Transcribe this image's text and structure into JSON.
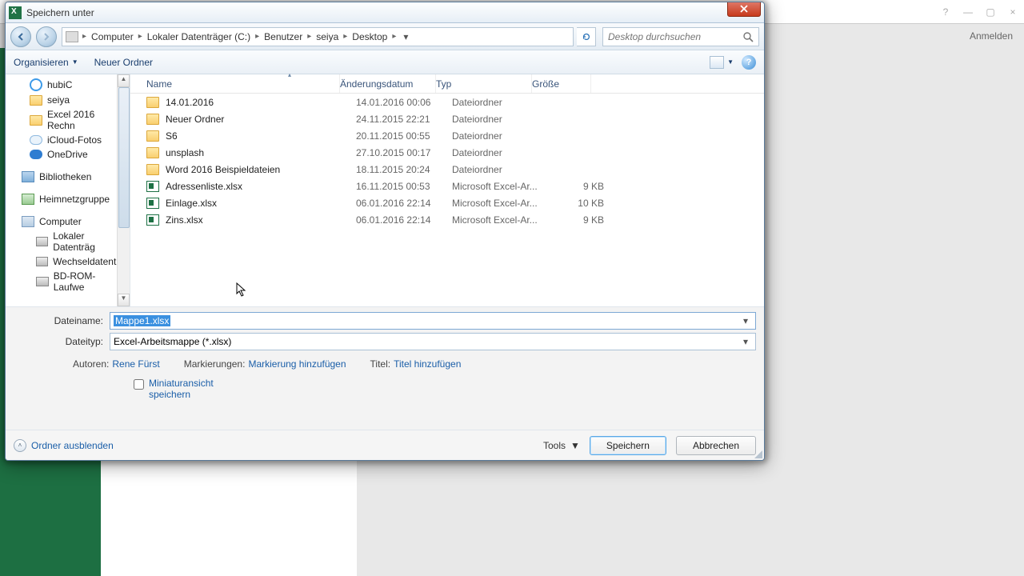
{
  "bg": {
    "anmelden": "Anmelden",
    "help": "?",
    "min": "—",
    "max": "▢",
    "close": "×"
  },
  "dialog": {
    "title": "Speichern unter",
    "breadcrumb": [
      "Computer",
      "Lokaler Datenträger (C:)",
      "Benutzer",
      "seiya",
      "Desktop"
    ],
    "search_placeholder": "Desktop durchsuchen",
    "toolbar": {
      "organize": "Organisieren",
      "new_folder": "Neuer Ordner"
    },
    "tree": [
      {
        "icon": "hubic",
        "label": "hubiC",
        "indent": "item"
      },
      {
        "icon": "folder",
        "label": "seiya",
        "indent": "item"
      },
      {
        "icon": "folder",
        "label": "Excel 2016 Rechn",
        "indent": "item"
      },
      {
        "icon": "cloud",
        "label": "iCloud-Fotos",
        "indent": "item"
      },
      {
        "icon": "onedrive",
        "label": "OneDrive",
        "indent": "item"
      },
      {
        "icon": "lib",
        "label": "Bibliotheken",
        "indent": "top"
      },
      {
        "icon": "net",
        "label": "Heimnetzgruppe",
        "indent": "top"
      },
      {
        "icon": "comp",
        "label": "Computer",
        "indent": "top"
      },
      {
        "icon": "drive",
        "label": "Lokaler Datenträg",
        "indent": "sub"
      },
      {
        "icon": "drive",
        "label": "Wechseldatenträ",
        "indent": "sub"
      },
      {
        "icon": "drive",
        "label": "BD-ROM-Laufwe",
        "indent": "sub"
      }
    ],
    "columns": {
      "name": "Name",
      "date": "Änderungsdatum",
      "type": "Typ",
      "size": "Größe"
    },
    "rows": [
      {
        "icon": "folder",
        "name": "14.01.2016",
        "date": "14.01.2016 00:06",
        "type": "Dateiordner",
        "size": ""
      },
      {
        "icon": "folder",
        "name": "Neuer Ordner",
        "date": "24.11.2015 22:21",
        "type": "Dateiordner",
        "size": ""
      },
      {
        "icon": "folder",
        "name": "S6",
        "date": "20.11.2015 00:55",
        "type": "Dateiordner",
        "size": ""
      },
      {
        "icon": "folder",
        "name": "unsplash",
        "date": "27.10.2015 00:17",
        "type": "Dateiordner",
        "size": ""
      },
      {
        "icon": "folder",
        "name": "Word 2016 Beispieldateien",
        "date": "18.11.2015 20:24",
        "type": "Dateiordner",
        "size": ""
      },
      {
        "icon": "excel",
        "name": "Adressenliste.xlsx",
        "date": "16.11.2015 00:53",
        "type": "Microsoft Excel-Ar...",
        "size": "9 KB"
      },
      {
        "icon": "excel",
        "name": "Einlage.xlsx",
        "date": "06.01.2016 22:14",
        "type": "Microsoft Excel-Ar...",
        "size": "10 KB"
      },
      {
        "icon": "excel",
        "name": "Zins.xlsx",
        "date": "06.01.2016 22:14",
        "type": "Microsoft Excel-Ar...",
        "size": "9 KB"
      }
    ],
    "filename_label": "Dateiname:",
    "filename_value": "Mappe1.xlsx",
    "filetype_label": "Dateityp:",
    "filetype_value": "Excel-Arbeitsmappe (*.xlsx)",
    "meta": {
      "authors_k": "Autoren:",
      "authors_v": "Rene Fürst",
      "tags_k": "Markierungen:",
      "tags_v": "Markierung hinzufügen",
      "title_k": "Titel:",
      "title_v": "Titel hinzufügen"
    },
    "thumb_chk": "Miniaturansicht speichern",
    "hide_folders": "Ordner ausblenden",
    "tools": "Tools",
    "save": "Speichern",
    "cancel": "Abbrechen"
  }
}
